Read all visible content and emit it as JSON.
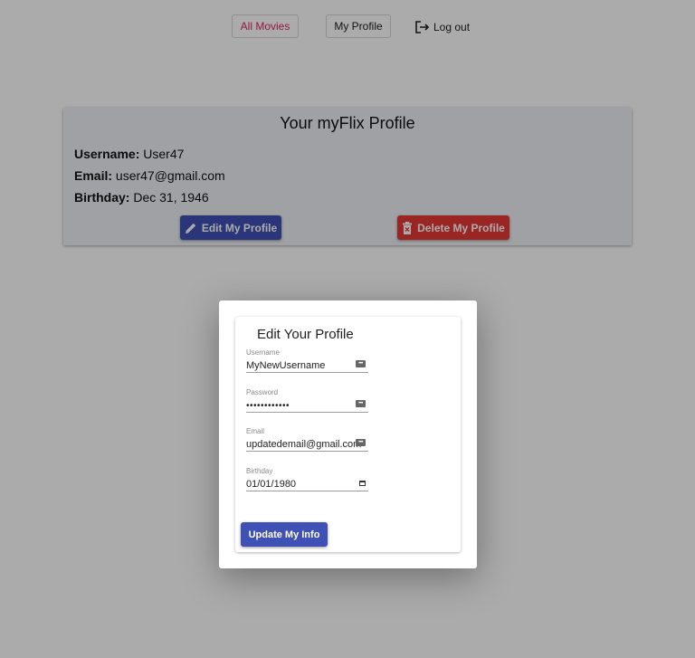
{
  "nav": {
    "all_movies": "All Movies",
    "my_profile": "My Profile",
    "log_out": "Log out"
  },
  "profile": {
    "title": "Your myFlix Profile",
    "username_label": "Username:",
    "username_value": "User47",
    "email_label": "Email:",
    "email_value": "user47@gmail.com",
    "birthday_label": "Birthday:",
    "birthday_value": "Dec 31, 1946",
    "edit_button": "Edit My Profile",
    "delete_button": "Delete My Profile"
  },
  "modal": {
    "title": "Edit Your Profile",
    "fields": [
      {
        "label": "Username",
        "value": "MyNewUsername",
        "icon": "password-manager-icon"
      },
      {
        "label": "Password",
        "value": "••••••••••••",
        "icon": "password-manager-icon"
      },
      {
        "label": "Email",
        "value": "updatedemail@gmail.com",
        "icon": "password-manager-icon"
      },
      {
        "label": "Birthday",
        "value": "01/01/1980",
        "icon": "calendar-icon"
      }
    ],
    "submit_button": "Update My Info"
  },
  "colors": {
    "primary": "#3f51b5",
    "danger": "#e53935",
    "accent_link": "#e0245e"
  }
}
